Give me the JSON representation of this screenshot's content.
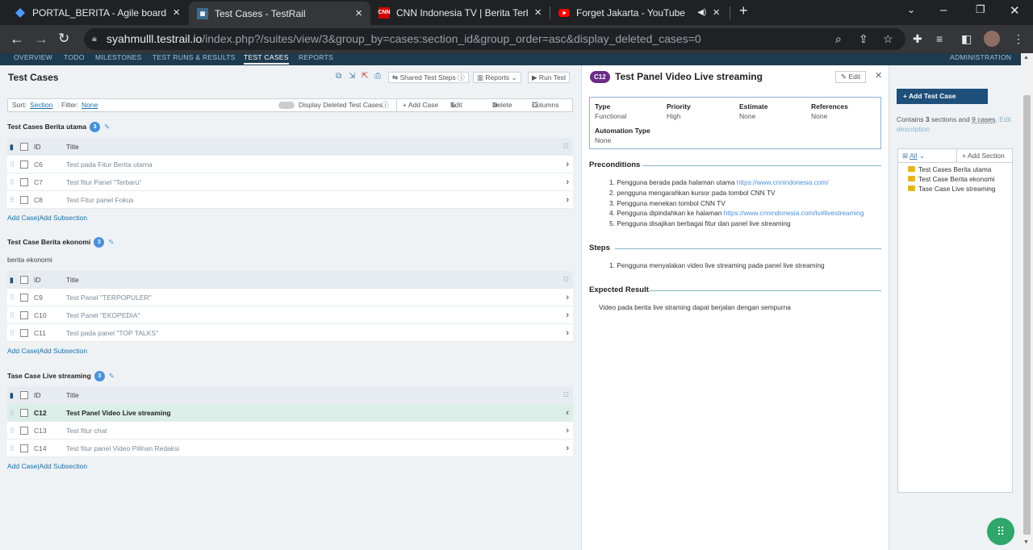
{
  "browser": {
    "tabs": [
      {
        "title": "PORTAL_BERITA - Agile board - Ji",
        "icon": "jira-icon"
      },
      {
        "title": "Test Cases - TestRail",
        "icon": "testrail-icon"
      },
      {
        "title": "CNN Indonesia TV | Berita Terbar",
        "icon": "cnn-icon"
      },
      {
        "title": "Forget Jakarta - YouTube",
        "icon": "youtube-icon"
      }
    ],
    "url_host": "syahmulll.testrail.io",
    "url_path": "/index.php?/suites/view/3&group_by=cases:section_id&group_order=asc&display_deleted_cases=0"
  },
  "topnav": {
    "items": [
      "OVERVIEW",
      "TODO",
      "MILESTONES",
      "TEST RUNS & RESULTS",
      "TEST CASES",
      "REPORTS"
    ],
    "admin": "ADMINISTRATION"
  },
  "left": {
    "title": "Test Cases",
    "toolbar": {
      "shared": "Shared Test Steps",
      "reports": "Reports",
      "run": "Run Test"
    },
    "sortbar": {
      "sort_label": "Sort:",
      "sort_value": "Section",
      "filter_label": "Filter:",
      "filter_value": "None",
      "display_deleted": "Display Deleted Test Cases",
      "add_case": "+ Add Case",
      "edit": "Edit",
      "delete": "Delete",
      "columns": "Columns"
    },
    "col_id": "ID",
    "col_title": "Title",
    "add_case": "Add Case",
    "pipe": "|",
    "add_subsection": "Add Subsection",
    "sections": [
      {
        "name": "Test Cases Berita utama",
        "count": "3",
        "desc": "",
        "rows": [
          {
            "id": "C6",
            "title": "Test pada Fitur Berita utama"
          },
          {
            "id": "C7",
            "title": "Test fitur Panel \"Terbaru\""
          },
          {
            "id": "C8",
            "title": "Test Fitur panel Fokus"
          }
        ]
      },
      {
        "name": "Test Case Berita ekonomi",
        "count": "3",
        "desc": "berita ekonomi",
        "rows": [
          {
            "id": "C9",
            "title": "Test Panel \"TERPOPULER\""
          },
          {
            "id": "C10",
            "title": "Test Panel \"EKOPEDIA\""
          },
          {
            "id": "C11",
            "title": "Test pada panel \"TOP TALKS\""
          }
        ]
      },
      {
        "name": "Tase Case Live streaming",
        "count": "3",
        "desc": "",
        "rows": [
          {
            "id": "C12",
            "title": "Test Panel Video Live streaming"
          },
          {
            "id": "C13",
            "title": "Test fitur chat"
          },
          {
            "id": "C14",
            "title": "Test fitur panel Video Pilihan Redaksi"
          }
        ]
      }
    ]
  },
  "detail": {
    "case_id": "C12",
    "title": "Test Panel Video Live streaming",
    "edit": "Edit",
    "props": {
      "type_label": "Type",
      "type": "Functional",
      "priority_label": "Priority",
      "priority": "High",
      "estimate_label": "Estimate",
      "estimate": "None",
      "references_label": "References",
      "references": "None",
      "automation_label": "Automation Type",
      "automation": "None"
    },
    "preconditions_label": "Preconditions",
    "preconditions": [
      {
        "text": "1. Pengguna berada pada halaman utama ",
        "link": "https://www.cnnindonesia.com/"
      },
      {
        "text": "2. pengguna mengarahkan kursor pada tombol CNN TV",
        "link": ""
      },
      {
        "text": "3. Pengguna menekan tombol CNN TV",
        "link": ""
      },
      {
        "text": "4. Pengguna dipindahkan ke halaman ",
        "link": "https://www.cnnindonesia.com/tv#livestreaming"
      },
      {
        "text": "5. Pengguna disajikan berbagai fitur dan panel  live streaming",
        "link": ""
      }
    ],
    "steps_label": "Steps",
    "steps": [
      "1. Pengguna menyalakan video live streaming pada panel live streaming"
    ],
    "expected_label": "Expected Result",
    "expected": "Video pada berita live straming dapat berjalan dengan sempurna"
  },
  "sidebar": {
    "add_test_case": "+ Add Test Case",
    "contains_pre": "Contains ",
    "sections_count": "3",
    "contains_mid": " sections and ",
    "cases_count": "9 cases",
    "contains_post": ". ",
    "edit_description": "Edit description",
    "filter_all": "All",
    "add_section": "+ Add Section",
    "tree": [
      "Test Cases Berita utama",
      "Test Case Berita ekonomi",
      "Tase Case Live streaming"
    ]
  }
}
